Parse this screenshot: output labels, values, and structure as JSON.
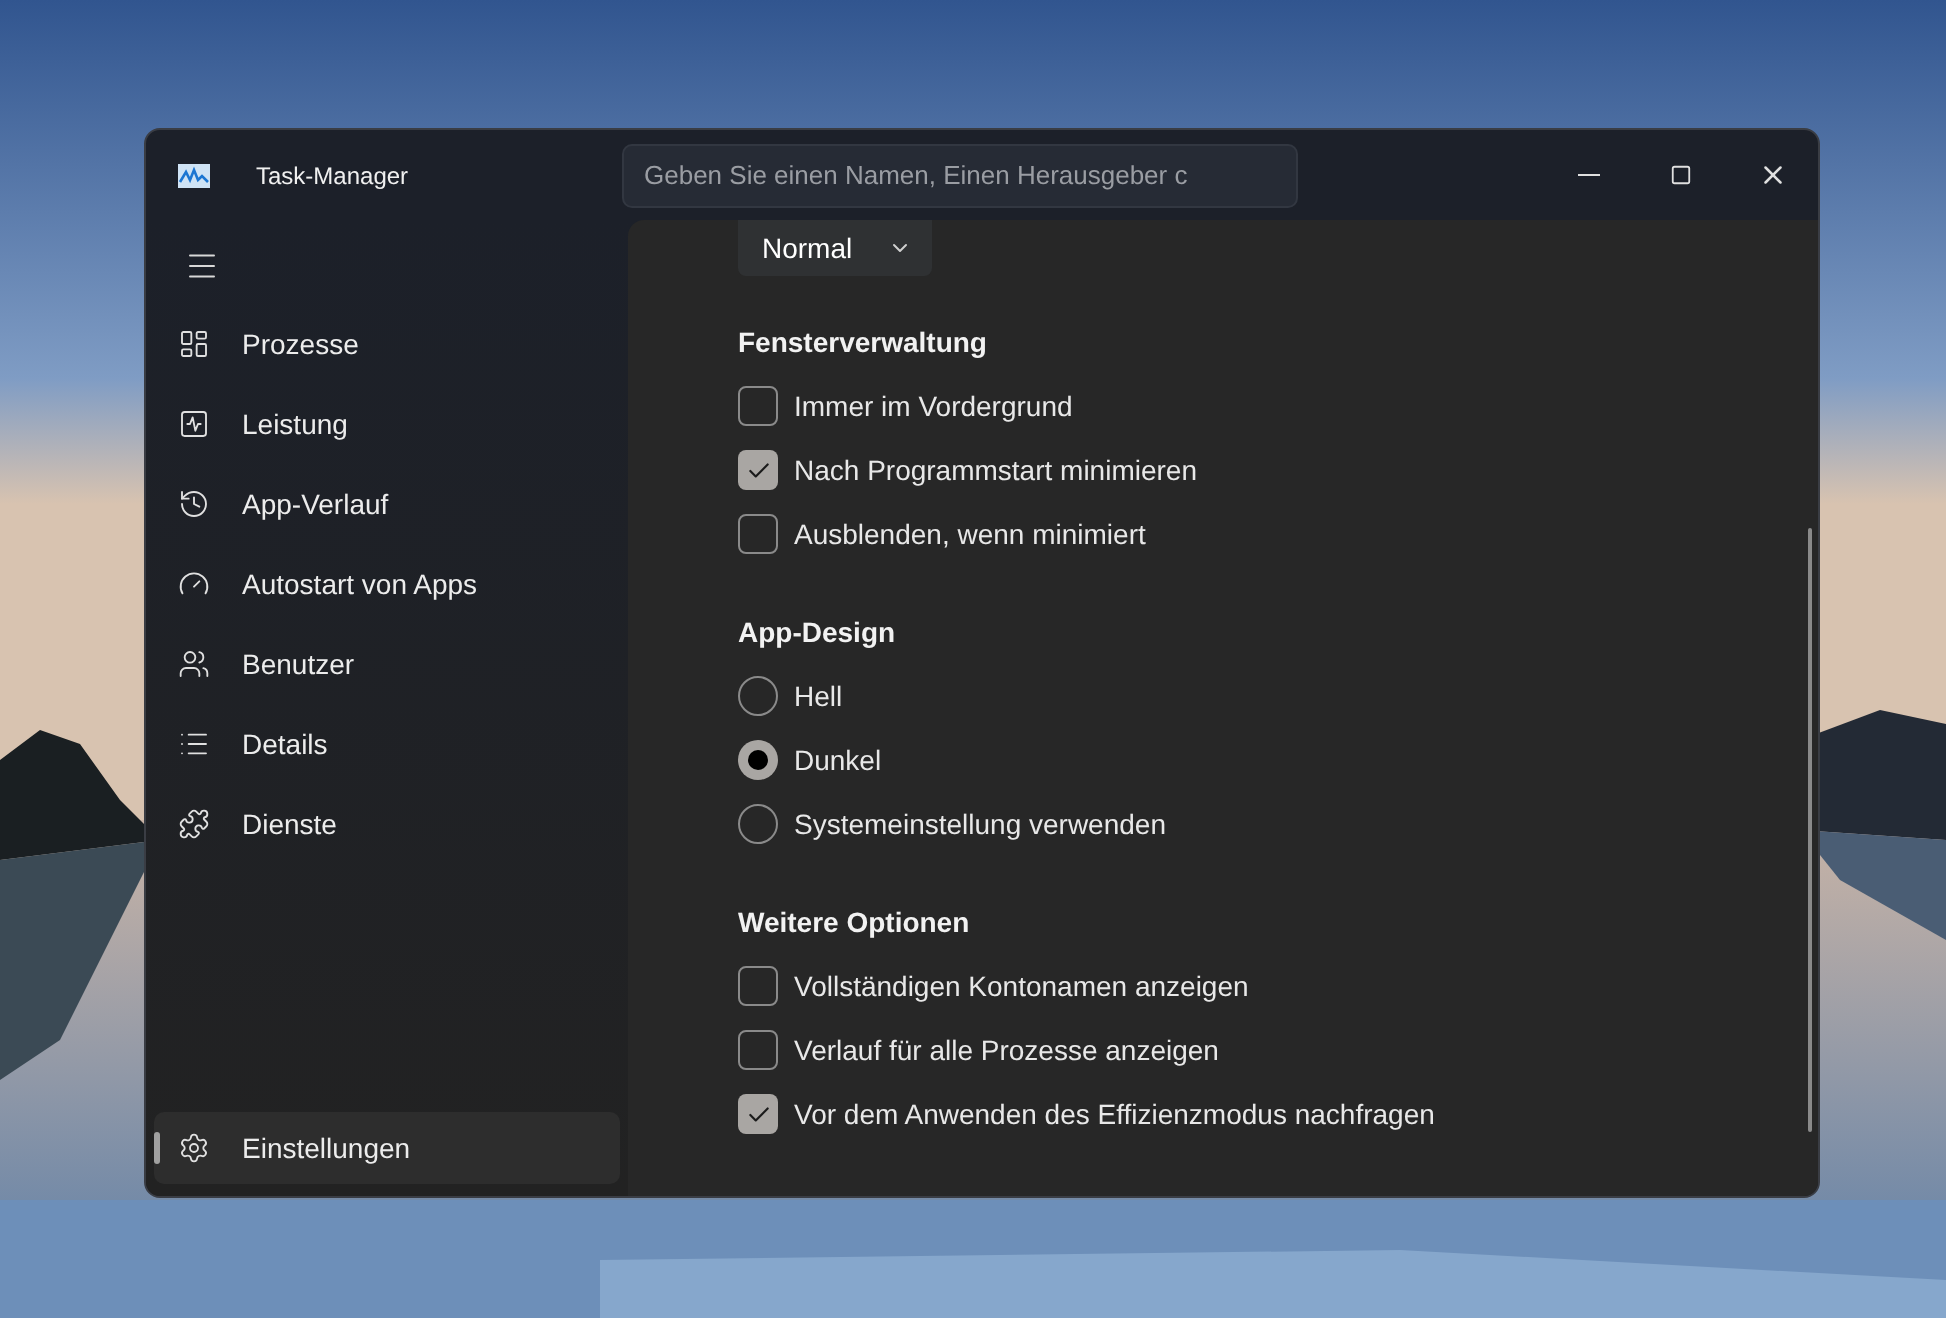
{
  "window": {
    "title": "Task-Manager"
  },
  "search": {
    "placeholder": "Geben Sie einen Namen, Einen Herausgeber c"
  },
  "sidebar": {
    "items": [
      {
        "label": "Prozesse",
        "selected": false
      },
      {
        "label": "Leistung",
        "selected": false
      },
      {
        "label": "App-Verlauf",
        "selected": false
      },
      {
        "label": "Autostart von Apps",
        "selected": false
      },
      {
        "label": "Benutzer",
        "selected": false
      },
      {
        "label": "Details",
        "selected": false
      },
      {
        "label": "Dienste",
        "selected": false
      }
    ],
    "settings": {
      "label": "Einstellungen",
      "selected": true
    }
  },
  "content": {
    "dropdown": {
      "value": "Normal"
    },
    "sections": [
      {
        "title": "Fensterverwaltung",
        "options": [
          {
            "kind": "checkbox",
            "label": "Immer im Vordergrund",
            "checked": false
          },
          {
            "kind": "checkbox",
            "label": "Nach Programmstart minimieren",
            "checked": true
          },
          {
            "kind": "checkbox",
            "label": "Ausblenden, wenn minimiert",
            "checked": false
          }
        ]
      },
      {
        "title": "App-Design",
        "options": [
          {
            "kind": "radio",
            "label": "Hell",
            "selected": false
          },
          {
            "kind": "radio",
            "label": "Dunkel",
            "selected": true
          },
          {
            "kind": "radio",
            "label": "Systemeinstellung verwenden",
            "selected": false
          }
        ]
      },
      {
        "title": "Weitere Optionen",
        "options": [
          {
            "kind": "checkbox",
            "label": "Vollständigen Kontonamen anzeigen",
            "checked": false
          },
          {
            "kind": "checkbox",
            "label": "Verlauf für alle Prozesse anzeigen",
            "checked": false
          },
          {
            "kind": "checkbox",
            "label": "Vor dem Anwenden des Effizienzmodus nachfragen",
            "checked": true
          }
        ]
      }
    ]
  }
}
